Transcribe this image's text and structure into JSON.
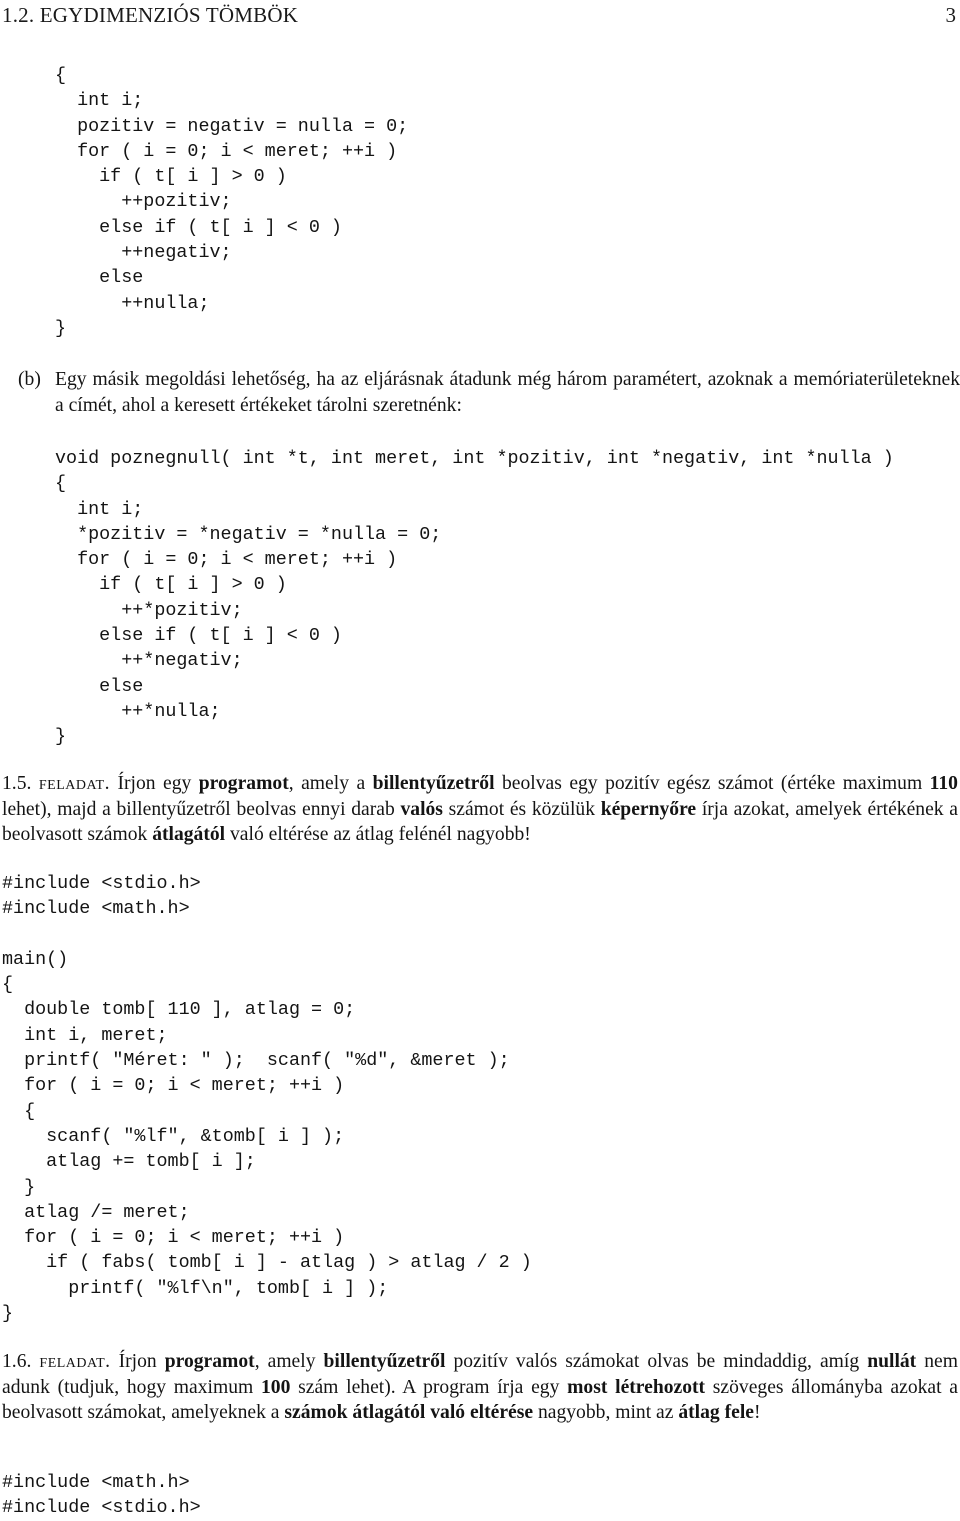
{
  "header": {
    "section_title": "1.2. EGYDIMENZIÓS TÖMBÖK",
    "page_number": "3"
  },
  "code_block_1": {
    "lines": [
      "{",
      "  int i;",
      "  pozitiv = negativ = nulla = 0;",
      "  for ( i = 0; i < meret; ++i )",
      "    if ( t[ i ] > 0 )",
      "      ++pozitiv;",
      "    else if ( t[ i ] < 0 )",
      "      ++negativ;",
      "    else",
      "      ++nulla;",
      "}"
    ]
  },
  "item_b": {
    "marker": "(b)",
    "text": "Egy másik megoldási lehetőség, ha az eljárásnak átadunk még három paramétert, azoknak a memóriaterületeknek a címét, ahol a keresett értékeket tárolni szeretnénk:"
  },
  "code_block_2": {
    "lines": [
      "void poznegnull( int *t, int meret, int *pozitiv, int *negativ, int *nulla )",
      "{",
      "  int i;",
      "  *pozitiv = *negativ = *nulla = 0;",
      "  for ( i = 0; i < meret; ++i )",
      "    if ( t[ i ] > 0 )",
      "      ++*pozitiv;",
      "    else if ( t[ i ] < 0 )",
      "      ++*negativ;",
      "    else",
      "      ++*nulla;",
      "}"
    ]
  },
  "exercise_1_5": {
    "number": "1.5.",
    "label": "feladat.",
    "segments": [
      {
        "text": "Írjon egy ",
        "bold": false
      },
      {
        "text": "programot",
        "bold": true
      },
      {
        "text": ", amely a ",
        "bold": false
      },
      {
        "text": "billentyűzetről",
        "bold": true
      },
      {
        "text": " beolvas egy pozitív egész számot (értéke maximum ",
        "bold": false
      },
      {
        "text": "110",
        "bold": true
      },
      {
        "text": " lehet), majd a billentyűzetről beolvas ennyi darab ",
        "bold": false
      },
      {
        "text": "valós",
        "bold": true
      },
      {
        "text": " számot és közülük ",
        "bold": false
      },
      {
        "text": "képernyőre",
        "bold": true
      },
      {
        "text": " írja azokat, amelyek értékének a beolvasott számok ",
        "bold": false
      },
      {
        "text": "átlagától",
        "bold": true
      },
      {
        "text": " való eltérése az átlag felénél nagyobb!",
        "bold": false
      }
    ]
  },
  "code_block_3": {
    "lines": [
      "#include <stdio.h>",
      "#include <math.h>",
      "",
      "main()",
      "{",
      "  double tomb[ 110 ], atlag = 0;",
      "  int i, meret;",
      "  printf( \"Méret: \" );  scanf( \"%d\", &meret );",
      "  for ( i = 0; i < meret; ++i )",
      "  {",
      "    scanf( \"%lf\", &tomb[ i ] );",
      "    atlag += tomb[ i ];",
      "  }",
      "  atlag /= meret;",
      "  for ( i = 0; i < meret; ++i )",
      "    if ( fabs( tomb[ i ] - atlag ) > atlag / 2 )",
      "      printf( \"%lf\\n\", tomb[ i ] );",
      "}"
    ]
  },
  "exercise_1_6": {
    "number": "1.6.",
    "label": "feladat.",
    "segments": [
      {
        "text": "Írjon ",
        "bold": false
      },
      {
        "text": "programot",
        "bold": true
      },
      {
        "text": ", amely ",
        "bold": false
      },
      {
        "text": "billentyűzetről",
        "bold": true
      },
      {
        "text": " pozitív valós számokat olvas be mindaddig, amíg ",
        "bold": false
      },
      {
        "text": "nullát",
        "bold": true
      },
      {
        "text": " nem adunk (tudjuk, hogy maximum ",
        "bold": false
      },
      {
        "text": "100",
        "bold": true
      },
      {
        "text": " szám lehet). A program írja egy ",
        "bold": false
      },
      {
        "text": "most létrehozott",
        "bold": true
      },
      {
        "text": " szöveges állományba azokat a beolvasott számokat, amelyeknek a ",
        "bold": false
      },
      {
        "text": "számok átlagától való eltérése",
        "bold": true
      },
      {
        "text": " nagyobb, mint az ",
        "bold": false
      },
      {
        "text": "átlag fele",
        "bold": true
      },
      {
        "text": "!",
        "bold": false
      }
    ]
  },
  "code_block_4": {
    "lines": [
      "#include <math.h>",
      "#include <stdio.h>"
    ]
  }
}
